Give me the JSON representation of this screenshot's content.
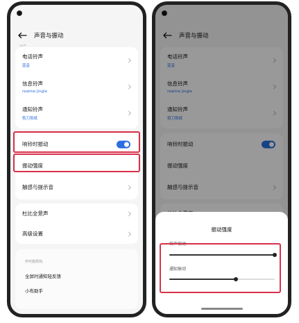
{
  "left": {
    "header": {
      "title": "声音与振动"
    },
    "cut_label": "铃声",
    "ringtones": [
      {
        "label": "电话铃声",
        "value": "蓝音"
      },
      {
        "label": "信息铃声",
        "value": "realme Jingle"
      },
      {
        "label": "通知铃声",
        "value": "剪刀剪纸"
      }
    ],
    "vibrate_on_ring": {
      "label": "响铃时振动",
      "enabled": true
    },
    "vibration_intensity": {
      "label": "振动强度"
    },
    "haptics": {
      "label": "触感与提示音"
    },
    "dolby": {
      "label": "杜比全景声"
    },
    "advanced": {
      "label": "高级设置"
    },
    "suggestions": {
      "hint": "你可能想找:",
      "items": [
        "全屏时通知轻反馈",
        "小布助手"
      ]
    }
  },
  "right": {
    "header": {
      "title": "声音与振动"
    },
    "ringtones": [
      {
        "label": "电话铃声",
        "value": "蓝音"
      },
      {
        "label": "信息铃声",
        "value": "realme Jingle"
      },
      {
        "label": "通知铃声",
        "value": "剪刀剪纸"
      }
    ],
    "vibrate_on_ring": {
      "label": "响铃时振动"
    },
    "vibration_intensity": {
      "label": "振动强度"
    },
    "haptics": {
      "label": "触感与提示音"
    },
    "dolby": {
      "label": "杜比全景声"
    },
    "sheet": {
      "title": "振动强度",
      "sliders": [
        {
          "label": "铃声振动",
          "level": 1.0
        },
        {
          "label": "通知振动",
          "level": 0.63
        }
      ]
    }
  },
  "colors": {
    "accent": "#2a6ee0",
    "highlight": "#d9304a"
  }
}
